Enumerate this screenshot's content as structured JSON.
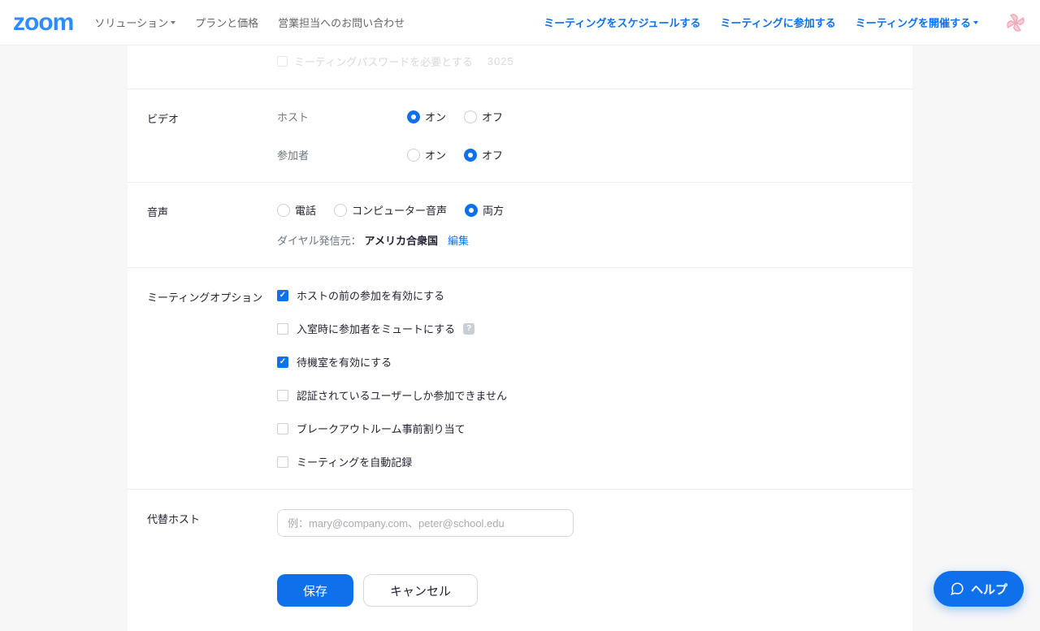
{
  "header": {
    "logo": "zoom",
    "nav_left": {
      "solutions": "ソリューション",
      "pricing": "プランと価格",
      "contact_sales": "営業担当へのお問い合わせ"
    },
    "nav_right": {
      "schedule": "ミーティングをスケジュールする",
      "join": "ミーティングに参加する",
      "host": "ミーティングを開催する"
    }
  },
  "faint_row_text": "ミーティングパスワードを必要とする",
  "faint_row_code": "3025",
  "sections": {
    "video": {
      "label": "ビデオ",
      "host_label": "ホスト",
      "participant_label": "参加者",
      "on": "オン",
      "off": "オフ",
      "host_value": "on",
      "participant_value": "off"
    },
    "audio": {
      "label": "音声",
      "phone": "電話",
      "computer": "コンピューター音声",
      "both": "両方",
      "value": "both",
      "dial_from_label": "ダイヤル発信元：",
      "country": "アメリカ合衆国",
      "edit": "編集"
    },
    "options": {
      "label": "ミーティングオプション",
      "items": [
        {
          "id": "join_before_host",
          "label": "ホストの前の参加を有効にする",
          "checked": true
        },
        {
          "id": "mute_on_entry",
          "label": "入室時に参加者をミュートにする",
          "checked": false,
          "info": true
        },
        {
          "id": "waiting_room",
          "label": "待機室を有効にする",
          "checked": true
        },
        {
          "id": "auth_only",
          "label": "認証されているユーザーしか参加できません",
          "checked": false
        },
        {
          "id": "breakout_preassign",
          "label": "ブレークアウトルーム事前割り当て",
          "checked": false
        },
        {
          "id": "auto_record",
          "label": "ミーティングを自動記録",
          "checked": false
        }
      ]
    },
    "alt_host": {
      "label": "代替ホスト",
      "placeholder": "例：mary@company.com、peter@school.edu"
    }
  },
  "actions": {
    "save": "保存",
    "cancel": "キャンセル"
  },
  "help": "ヘルプ"
}
